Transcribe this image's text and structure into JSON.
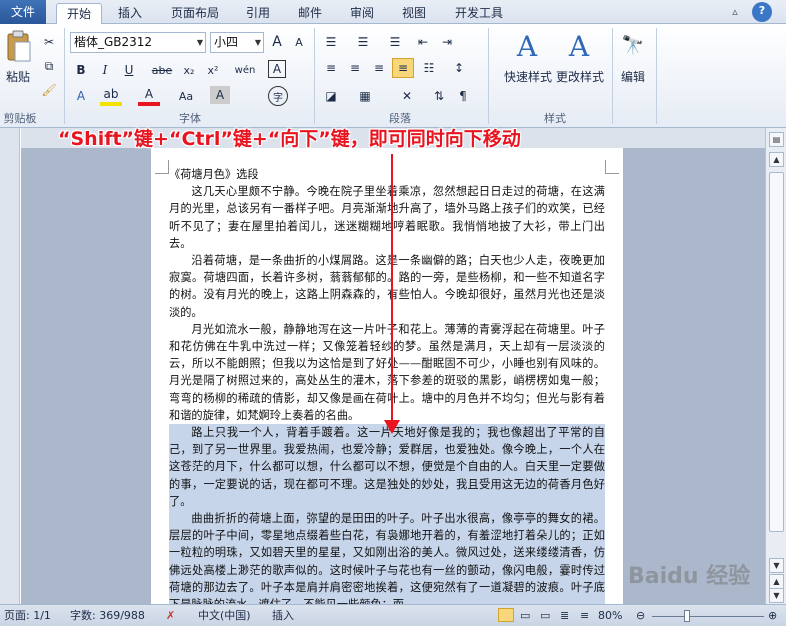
{
  "tabs": {
    "file": "文件",
    "home": "开始",
    "insert": "插入",
    "page_layout": "页面布局",
    "references": "引用",
    "mailings": "邮件",
    "review": "审阅",
    "view": "视图",
    "developer": "开发工具"
  },
  "clipboard": {
    "paste_label": "粘贴",
    "group_label": "剪贴板"
  },
  "font": {
    "name": "楷体_GB2312",
    "size": "小四",
    "group_label": "字体",
    "bold": "B",
    "italic": "I",
    "underline": "U",
    "strike": "abe",
    "subscript": "x₂",
    "superscript": "x²",
    "case": "Aa",
    "grow": "A",
    "shrink": "A",
    "wen": "wén",
    "char_border": "A",
    "char_shading": "A",
    "enclose": "字"
  },
  "paragraph": {
    "group_label": "段落"
  },
  "styles": {
    "quick_styles": "快速样式",
    "change_styles": "更改样式",
    "group_label": "样式"
  },
  "editing": {
    "label": "编辑"
  },
  "annotation": "“Shift”键+“Ctrl”键+“向下”键，即可同时向下移动",
  "document": {
    "title": "《荷塘月色》选段",
    "paragraphs": [
      "这几天心里颇不宁静。今晚在院子里坐着乘凉，忽然想起日日走过的荷塘，在这满月的光里，总该另有一番样子吧。月亮渐渐地升高了，墙外马路上孩子们的欢笑，已经听不见了；妻在屋里拍着闰儿，迷迷糊糊地哼着眠歌。我悄悄地披了大衫，带上门出去。",
      "沿着荷塘，是一条曲折的小煤屑路。这是一条幽僻的路；白天也少人走，夜晚更加寂寞。荷塘四面，长着许多树，蓊蓊郁郁的。路的一旁，是些杨柳，和一些不知道名字的树。没有月光的晚上，这路上阴森森的，有些怕人。今晚却很好，虽然月光也还是淡淡的。",
      "月光如流水一般，静静地泻在这一片叶子和花上。薄薄的青雾浮起在荷塘里。叶子和花仿佛在牛乳中洗过一样；又像笼着轻纱的梦。虽然是满月，天上却有一层淡淡的云，所以不能朗照；但我以为这恰是到了好处——酣眠固不可少，小睡也别有风味的。月光是隔了树照过来的，高处丛生的灌木，落下参差的斑驳的黑影，峭楞楞如鬼一般；弯弯的杨柳的稀疏的倩影，却又像是画在荷叶上。塘中的月色并不均匀；但光与影有着和谐的旋律，如梵婀玲上奏着的名曲。"
    ],
    "selected_paragraphs": [
      "路上只我一个人，背着手踱着。这一片天地好像是我的；我也像超出了平常的自己，到了另一世界里。我爱热闹，也爱冷静；爱群居，也爱独处。像今晚上，一个人在这苍茫的月下，什么都可以想，什么都可以不想，便觉是个自由的人。白天里一定要做的事，一定要说的话，现在都可不理。这是独处的妙处，我且受用这无边的荷香月色好了。",
      "曲曲折折的荷塘上面，弥望的是田田的叶子。叶子出水很高，像亭亭的舞女的裙。层层的叶子中间，零星地点缀着些白花，有袅娜地开着的，有羞涩地打着朵儿的；正如一粒粒的明珠，又如碧天里的星星，又如刚出浴的美人。微风过处，送来缕缕清香，仿佛远处高楼上渺茫的歌声似的。这时候叶子与花也有一丝的颤动，像闪电般，霎时传过荷塘的那边去了。叶子本是肩并肩密密地挨着，这便宛然有了一道凝碧的波痕。叶子底下是脉脉的流水，遮住了，不能见一些颜色；而"
    ]
  },
  "status": {
    "page": "页面: 1/1",
    "words": "字数: 369/988",
    "language": "中文(中国)",
    "insert_mode": "插入",
    "zoom": "80%"
  },
  "watermark": "Baidu 经验"
}
